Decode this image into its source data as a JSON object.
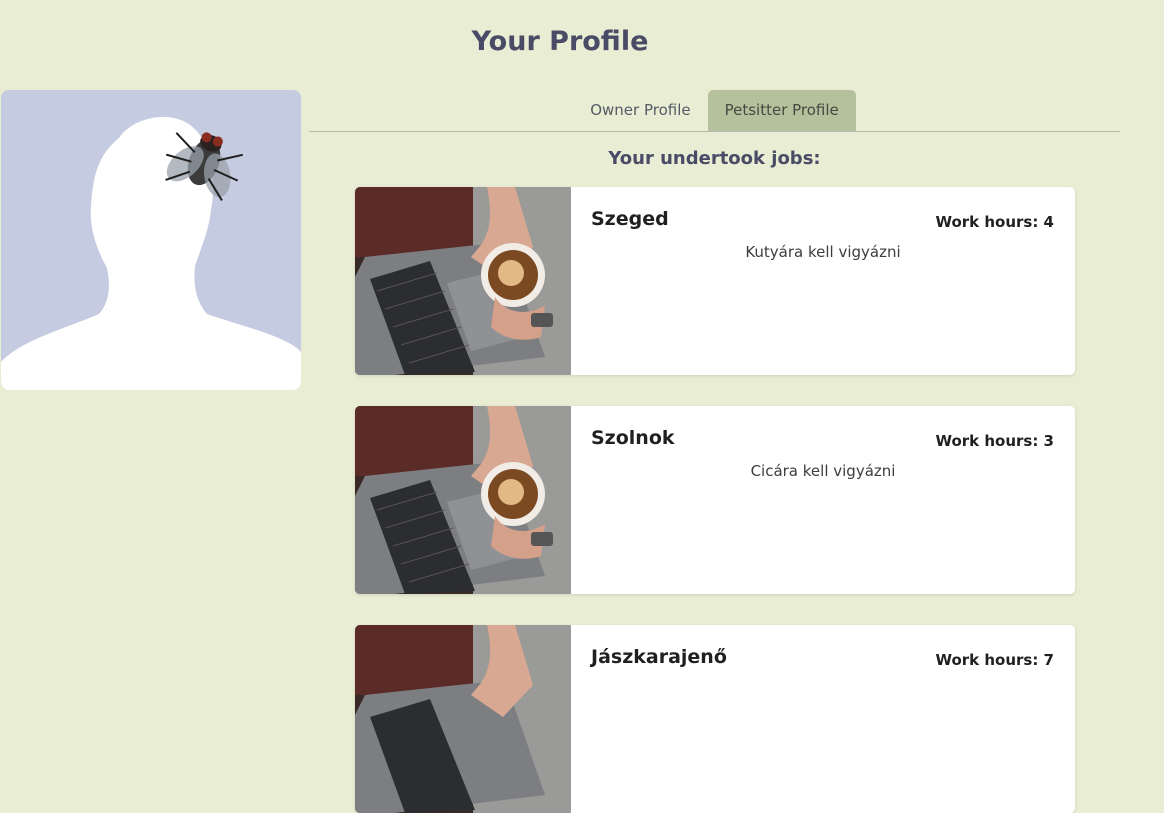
{
  "page": {
    "title": "Your Profile"
  },
  "profile": {
    "avatar_icon": "person-silhouette-with-fly"
  },
  "tabs": [
    {
      "label": "Owner Profile",
      "active": false
    },
    {
      "label": "Petsitter Profile",
      "active": true
    }
  ],
  "jobs_section": {
    "title": "Your undertook jobs:"
  },
  "jobs": [
    {
      "city": "Szeged",
      "hours": "Work hours: 4",
      "description": "Kutyára kell vigyázni",
      "image_icon": "laptop-coffee-photo"
    },
    {
      "city": "Szolnok",
      "hours": "Work hours: 3",
      "description": "Cicára kell vigyázni",
      "image_icon": "laptop-coffee-photo"
    },
    {
      "city": "Jászkarajenő",
      "hours": "Work hours: 7",
      "description": "",
      "image_icon": "laptop-coffee-photo"
    }
  ],
  "colors": {
    "background": "#e9edd3",
    "active_tab": "#b5c19d",
    "avatar_bg": "#c5cbe0"
  }
}
